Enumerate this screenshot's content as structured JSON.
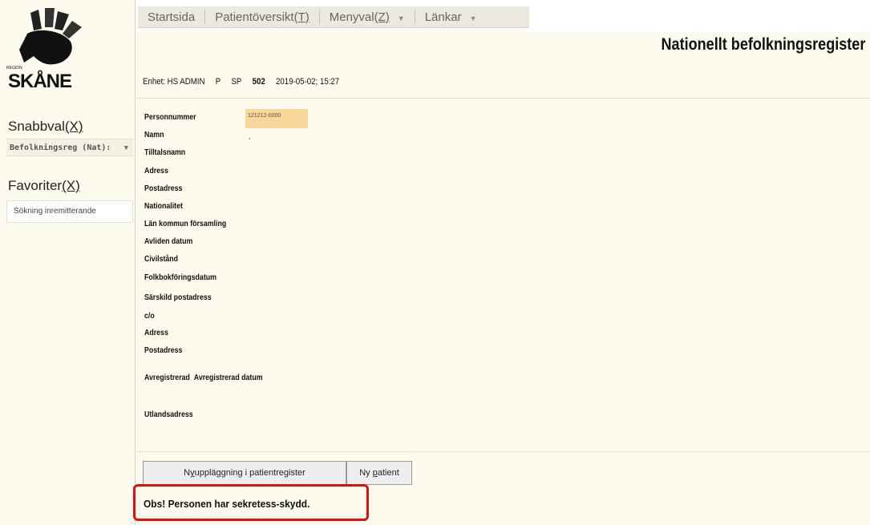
{
  "sidebar": {
    "logo_small": "REGION",
    "logo_text": "SKÅNE",
    "snabbval": {
      "label": "Snabbval",
      "key": "(X)"
    },
    "snabbval_select": "Befolkningsreg (Nat):",
    "favoriter": {
      "label": "Favoriter",
      "key": "(X)"
    },
    "favoriter_item": "Sökning inremitterande"
  },
  "topbar": {
    "startsida": "Startsida",
    "patientoversikt": {
      "label": "Patientöversikt",
      "key": "(T)"
    },
    "menyval": {
      "label": "Menyval",
      "key": "(Z)"
    },
    "lankar": "Länkar"
  },
  "page": {
    "title": "Nationellt befolkningsregister"
  },
  "info": {
    "enhet": "Enhet: HS ADMIN",
    "p": "P",
    "sp": "SP",
    "sp_num": "502",
    "datetime": "2019-05-02; 15:27"
  },
  "fields": {
    "personnummer": "Personnummer",
    "personnummer_value": "121212-0000",
    "namn": "Namn",
    "namn_value": ",",
    "tilltalsnamn": "Tilltalsnamn",
    "adress": "Adress",
    "postadress": "Postadress",
    "nationalitet": "Nationalitet",
    "lan_kommun": "Län kommun församling",
    "avliden": "Avliden datum",
    "civilstand": "Civilstånd",
    "folkbokforing": "Folkbokföringsdatum",
    "sarskild": "Särskild postadress",
    "co": "c/o",
    "adress2": "Adress",
    "postadress2": "Postadress",
    "avregistrerad": "Avregistrerad",
    "avregistrerad_datum": "Avregistrerad datum",
    "utlandsadress": "Utlandsadress"
  },
  "buttons": {
    "nyupplaggning": {
      "pre": "N",
      "u": "y",
      "post": "uppläggning i patientregister"
    },
    "ny_patient": {
      "pre": "Ny ",
      "u": "p",
      "post": "atient"
    }
  },
  "notice": "Obs! Personen har sekretess-skydd.",
  "colors": {
    "panel_bg": "#fdfbee",
    "highlight": "#f7d89a",
    "notice_border": "#e01010"
  }
}
